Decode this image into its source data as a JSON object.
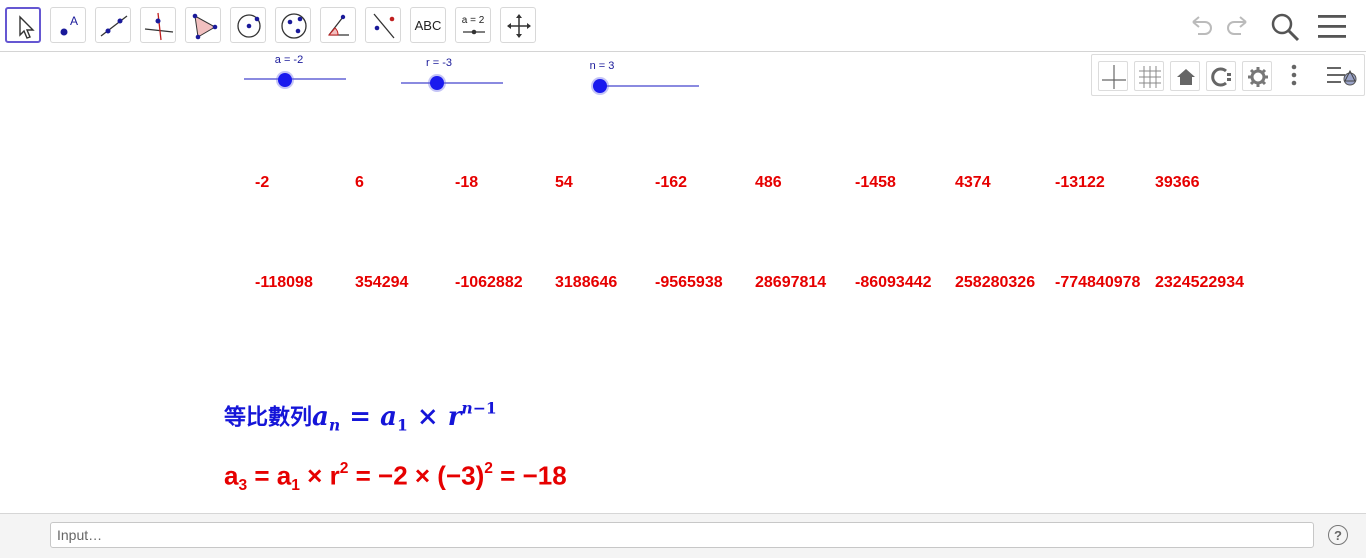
{
  "toolbar": {
    "tools": [
      {
        "name": "move",
        "icon": "cursor-arrow-icon"
      },
      {
        "name": "point",
        "icon": "point-icon"
      },
      {
        "name": "line",
        "icon": "line-icon"
      },
      {
        "name": "perpendicular",
        "icon": "perpendicular-line-icon"
      },
      {
        "name": "polygon",
        "icon": "polygon-icon"
      },
      {
        "name": "circle",
        "icon": "circle-center-point-icon"
      },
      {
        "name": "ellipse",
        "icon": "ellipse-icon"
      },
      {
        "name": "angle",
        "icon": "angle-icon"
      },
      {
        "name": "reflect",
        "icon": "reflect-icon"
      },
      {
        "name": "text",
        "icon": "text-icon",
        "label": "ABC"
      },
      {
        "name": "slider",
        "icon": "slider-icon",
        "label": "a = 2"
      },
      {
        "name": "move-graphics",
        "icon": "move-arrows-icon"
      }
    ],
    "right_icons": [
      "undo-icon",
      "redo-icon",
      "search-icon",
      "menu-icon"
    ]
  },
  "stylebar": {
    "buttons": [
      "axes-icon",
      "grid-icon",
      "home-icon",
      "point-capturing-icon",
      "gear-icon",
      "more-icon",
      "toggle-stylebar-icon"
    ]
  },
  "sliders": [
    {
      "label": "a = -2",
      "name": "a",
      "value": -2,
      "min": -5,
      "max": 5
    },
    {
      "label": "r = -3",
      "name": "r",
      "value": -3,
      "min": -5,
      "max": 5
    },
    {
      "label": "n = 3",
      "name": "n",
      "value": 3,
      "min": 1,
      "max": 20
    }
  ],
  "sequence": {
    "row1": [
      "-2",
      "6",
      "-18",
      "54",
      "-162",
      "486",
      "-1458",
      "4374",
      "-13122",
      "39366"
    ],
    "row2": [
      "-118098",
      "354294",
      "-1062882",
      "3188646",
      "-9565938",
      "28697814",
      "-86093442",
      "258280326",
      "-774840978",
      "2324522934"
    ]
  },
  "formula1": {
    "cjk": "等比數列",
    "math": "a_n = a_1 × r^(n−1)"
  },
  "formula2": {
    "text": "a₃ = a₁ × r² = −2 × (−3)² = −18"
  },
  "input": {
    "placeholder": "Input…",
    "value": ""
  },
  "help": {
    "symbol": "?"
  },
  "colors": {
    "accent": "#6557d2",
    "sequence": "#e60000",
    "formula_blue": "#1515d8",
    "slider": "#1a1aee"
  }
}
